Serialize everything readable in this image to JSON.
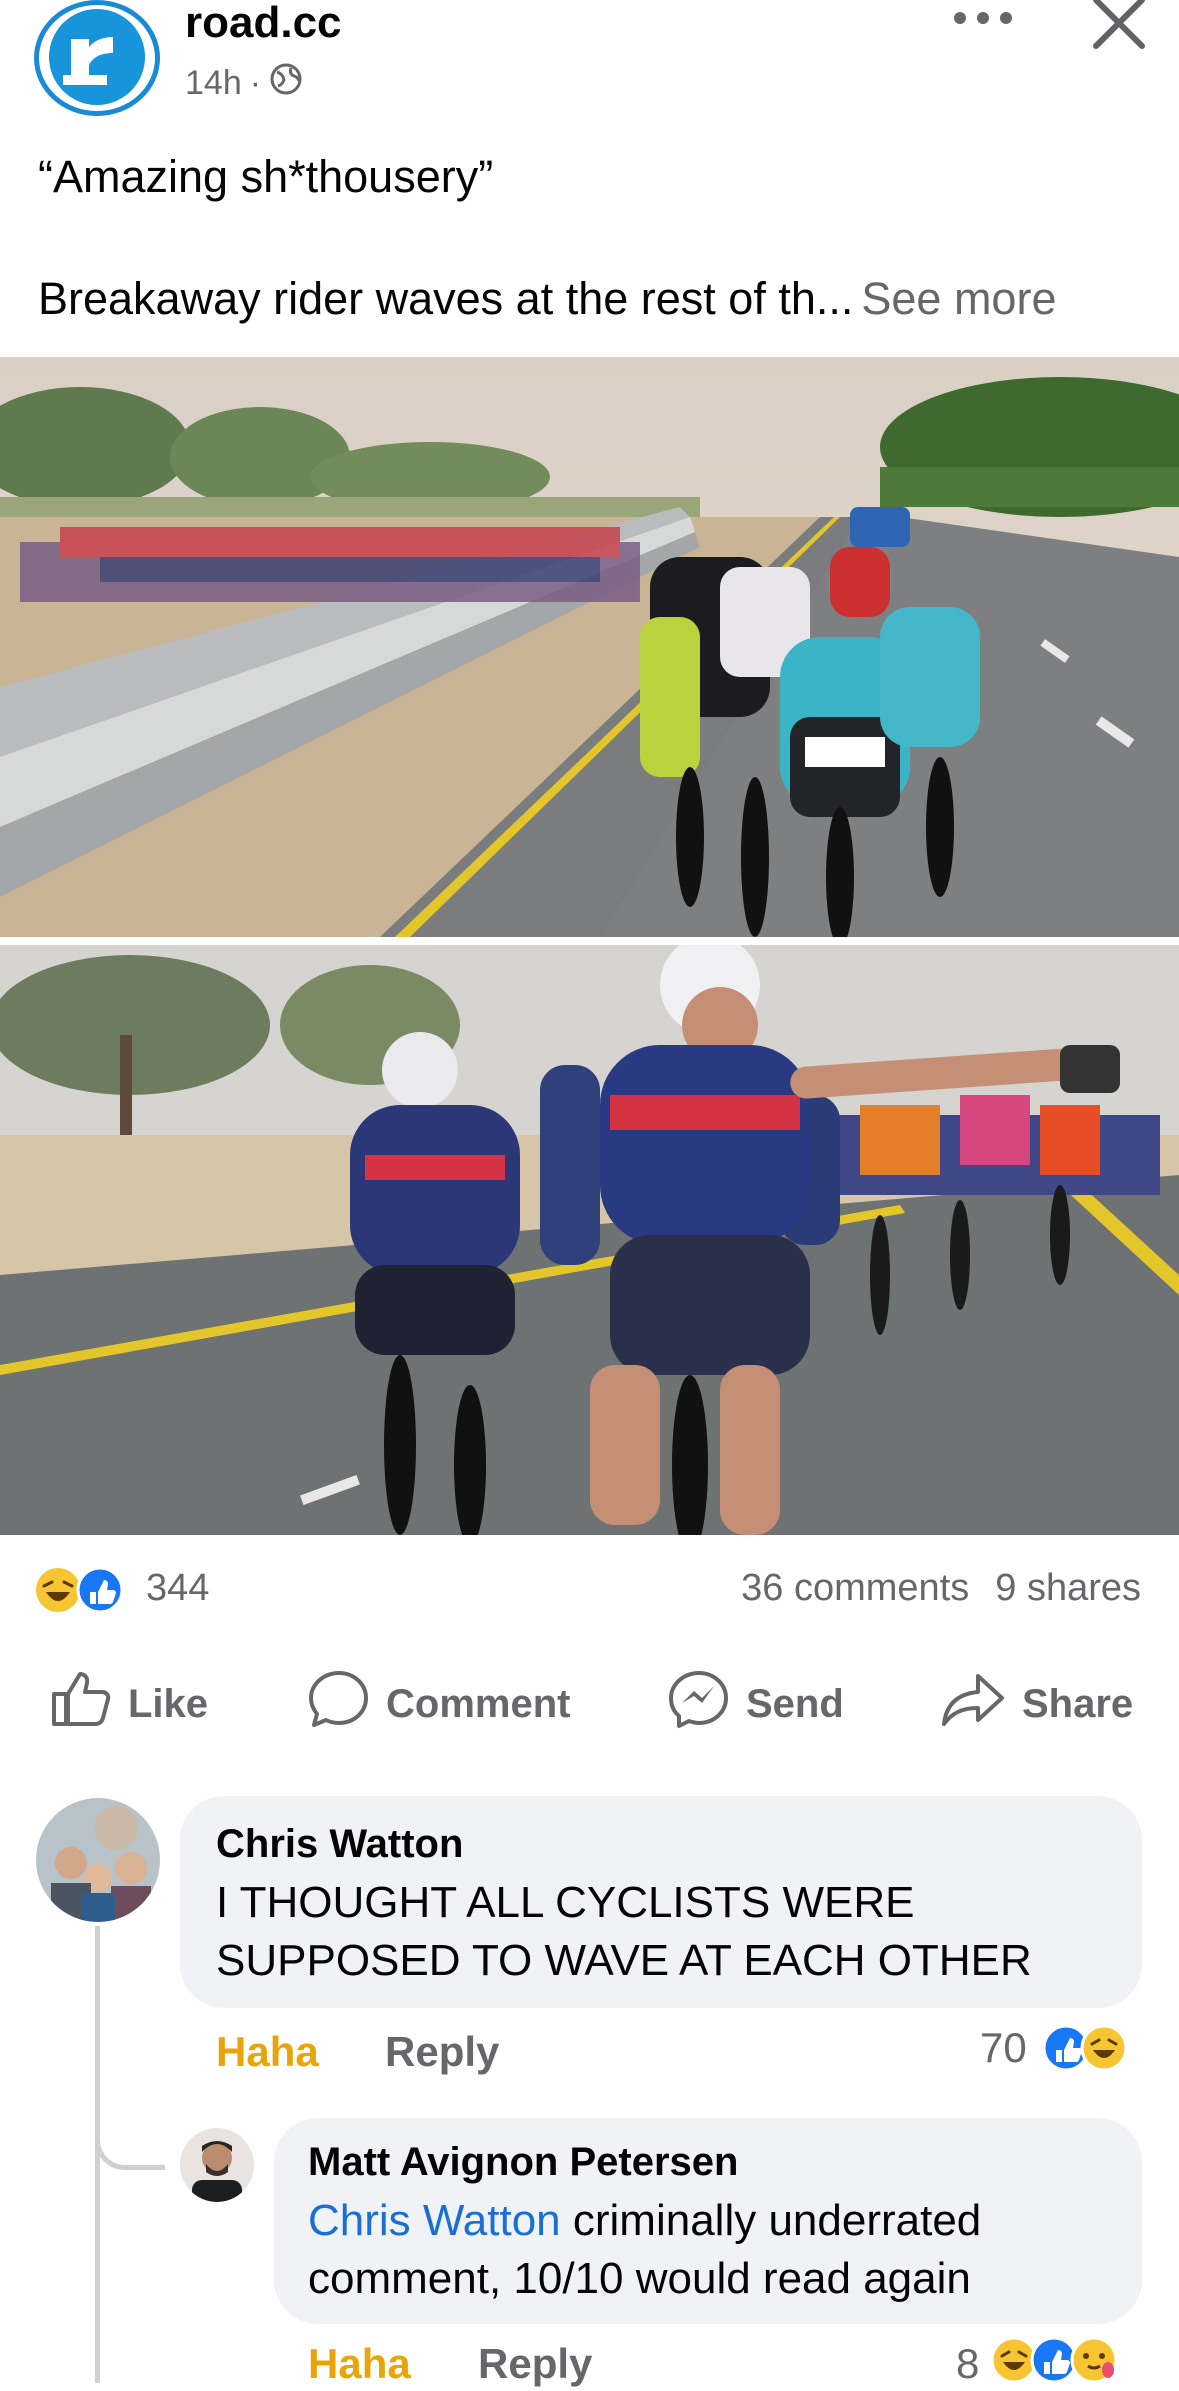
{
  "post": {
    "page_name": "road.cc",
    "time": "14h",
    "dot": "·",
    "title": "“Amazing sh*thousery”",
    "body": "Breakaway rider waves at the rest of th...",
    "see_more": "See more"
  },
  "engagement": {
    "reaction_count": "344",
    "comments": "36 comments",
    "shares": "9 shares"
  },
  "actions": {
    "like": "Like",
    "comment": "Comment",
    "send": "Send",
    "share": "Share"
  },
  "comments": [
    {
      "author": "Chris Watton",
      "text_line1": "I THOUGHT ALL CYCLISTS WERE",
      "text_line2": "SUPPOSED TO WAVE AT EACH OTHER",
      "reaction_label": "Haha",
      "reply_label": "Reply",
      "reaction_count": "70"
    },
    {
      "author": "Matt Avignon Petersen",
      "mention": "Chris Watton",
      "text_line1_rest": " criminally underrated",
      "text_line2": "comment, 10/10 would read again",
      "reaction_label": "Haha",
      "reply_label": "Reply",
      "reaction_count": "8"
    }
  ],
  "colors": {
    "brand_blue": "#1794da",
    "link_blue": "#1a6fd4",
    "haha_yellow": "#e8a50a",
    "muted_text": "#65676b",
    "bubble_bg": "#f0f2f5"
  },
  "icons": [
    "globe-icon",
    "more-icon",
    "close-icon",
    "like-icon",
    "comment-icon",
    "messenger-icon",
    "share-icon"
  ]
}
